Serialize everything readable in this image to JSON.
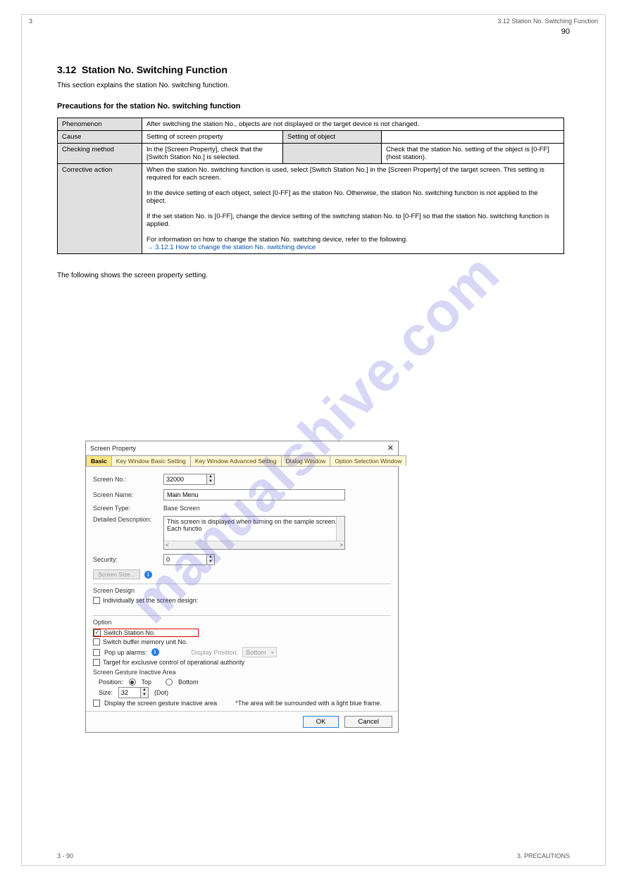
{
  "watermark": "manualshive.com",
  "header": {
    "left_num": "3",
    "right_section": "3.12 Station No. Switching Function",
    "page_number": "90"
  },
  "section": {
    "number": "3.12",
    "title": "Station No. Switching Function",
    "intro": "This section explains the station No. switching function.",
    "sub": "Precautions for the station No. switching function"
  },
  "table": {
    "r1c1": "Phenomenon",
    "r1c2": "After switching the station No., objects are not displayed or the target device is not changed.",
    "r2c1": "Cause",
    "r2c2": "Setting of screen property",
    "r2c3": "",
    "r3c1": "Checking method",
    "r3c2": "In the [Screen Property], check that the [Switch Station No.] is selected.",
    "r3c3": "Setting of object",
    "r3c4": "Check that the station No. setting of the object is [0-FF] (host station).",
    "corr_label": "Corrective action",
    "corr1": "When the station No. switching function is used, select [Switch Station No.] in the [Screen Property] of the target screen. This setting is required for each screen.",
    "corr2": "In the device setting of each object, select [0-FF] as the station No. Otherwise, the station No. switching function is not applied to the object.",
    "corr3": "If the set station No. is [0-FF], change the device setting of the switching station No. to [0-FF] so that the station No. switching function is applied.",
    "corr4": "For information on how to change the station No. switching device, refer to the following.",
    "corr5": "→ 3.12.1 How to change the station No. switching device"
  },
  "after_table": "The following shows the screen property setting.",
  "dialog": {
    "title": "Screen Property",
    "tabs": [
      "Basic",
      "Key Window Basic Setting",
      "Key Window Advanced Setting",
      "Dialog Window",
      "Option Selection Window"
    ],
    "screen_no_label": "Screen No.:",
    "screen_no_value": "32000",
    "screen_name_label": "Screen Name:",
    "screen_name_value": "Main Menu",
    "screen_type_label": "Screen Type:",
    "screen_type_value": "Base Screen",
    "detail_label": "Detailed Description:",
    "detail_value": "This screen is displayed when turning on the sample screen. Each functio",
    "security_label": "Security:",
    "security_value": "0",
    "screen_size_btn": "Screen Size...",
    "design_group": "Screen Design",
    "design_chk": "Individually set the screen design:",
    "option_group": "Option",
    "switch_station": "Switch Station No.",
    "switch_buffer": "Switch buffer memory unit No.",
    "popup_alarms": "Pop up alarms:",
    "display_pos_label": "Display Position:",
    "display_pos_value": "Bottom",
    "target_excl": "Target for exclusive control of operational authority",
    "gesture_group": "Screen Gesture Inactive Area",
    "position_label": "Position:",
    "radio_top": "Top",
    "radio_bottom": "Bottom",
    "size_label": "Size:",
    "size_value": "32",
    "size_unit": "(Dot)",
    "display_gesture": "Display the screen gesture inactive area",
    "gesture_note": "*The area will be surrounded with a light blue frame.",
    "ok": "OK",
    "cancel": "Cancel"
  },
  "footer": {
    "left": "3 - 90",
    "right": "3. PRECAUTIONS"
  }
}
